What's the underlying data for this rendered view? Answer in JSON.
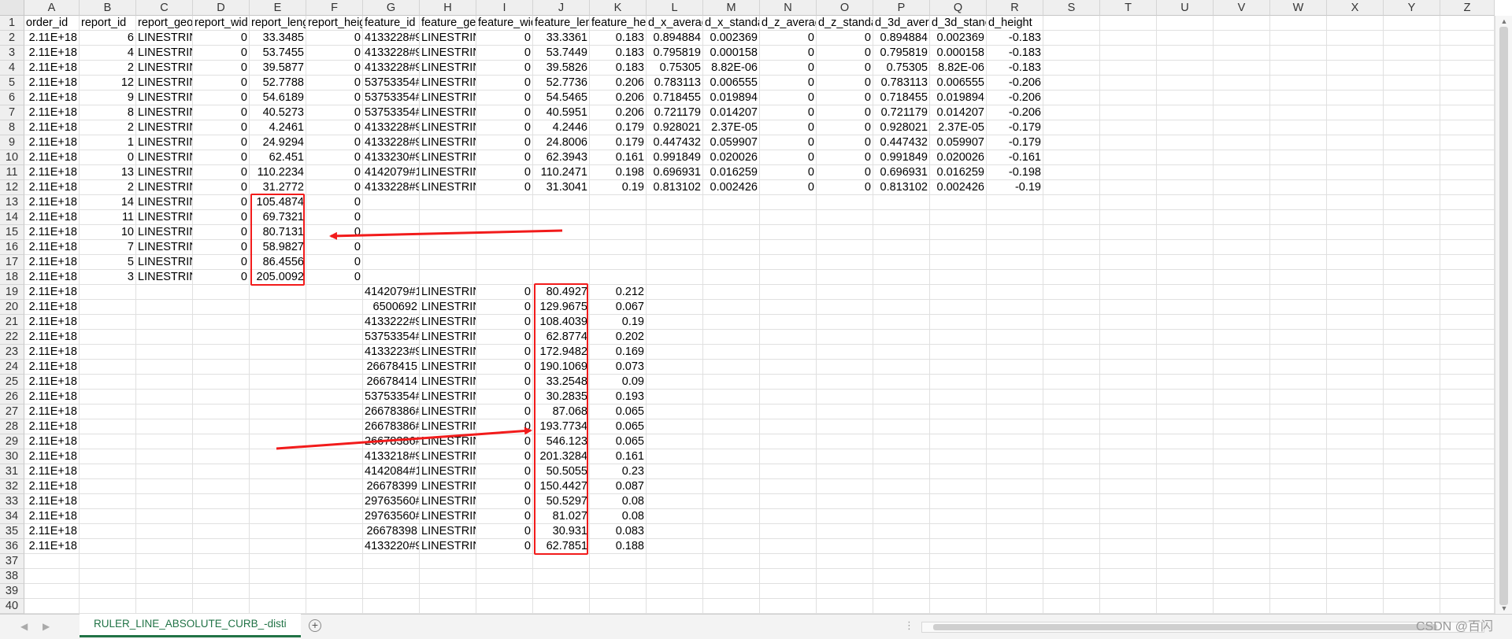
{
  "sheet": {
    "columns": [
      "A",
      "B",
      "C",
      "D",
      "E",
      "F",
      "G",
      "H",
      "I",
      "J",
      "K",
      "L",
      "M",
      "N",
      "O",
      "P",
      "Q",
      "R",
      "S",
      "T",
      "U",
      "V",
      "W",
      "X",
      "Y",
      "Z"
    ],
    "rows_count": 40,
    "headers": [
      "order_id",
      "report_id",
      "report_geo",
      "report_wid",
      "report_leng",
      "report_heig",
      "feature_id",
      "feature_ge",
      "feature_wid",
      "feature_len",
      "feature_he",
      "d_x_averag",
      "d_x_standa",
      "d_z_averag",
      "d_z_standa",
      "d_3d_avera",
      "d_3d_stanc",
      "d_height"
    ],
    "data": [
      [
        "2.11E+18",
        "6",
        "LINESTRIN",
        "0",
        "33.3485",
        "0",
        "4133228#9",
        "LINESTRIN",
        "0",
        "33.3361",
        "0.183",
        "0.894884",
        "0.002369",
        "0",
        "0",
        "0.894884",
        "0.002369",
        "-0.183"
      ],
      [
        "2.11E+18",
        "4",
        "LINESTRIN",
        "0",
        "53.7455",
        "0",
        "4133228#9",
        "LINESTRIN",
        "0",
        "53.7449",
        "0.183",
        "0.795819",
        "0.000158",
        "0",
        "0",
        "0.795819",
        "0.000158",
        "-0.183"
      ],
      [
        "2.11E+18",
        "2",
        "LINESTRIN",
        "0",
        "39.5877",
        "0",
        "4133228#9",
        "LINESTRIN",
        "0",
        "39.5826",
        "0.183",
        "0.75305",
        "8.82E-06",
        "0",
        "0",
        "0.75305",
        "8.82E-06",
        "-0.183"
      ],
      [
        "2.11E+18",
        "12",
        "LINESTRIN",
        "0",
        "52.7788",
        "0",
        "53753354#",
        "LINESTRIN",
        "0",
        "52.7736",
        "0.206",
        "0.783113",
        "0.006555",
        "0",
        "0",
        "0.783113",
        "0.006555",
        "-0.206"
      ],
      [
        "2.11E+18",
        "9",
        "LINESTRIN",
        "0",
        "54.6189",
        "0",
        "53753354#",
        "LINESTRIN",
        "0",
        "54.5465",
        "0.206",
        "0.718455",
        "0.019894",
        "0",
        "0",
        "0.718455",
        "0.019894",
        "-0.206"
      ],
      [
        "2.11E+18",
        "8",
        "LINESTRIN",
        "0",
        "40.5273",
        "0",
        "53753354#",
        "LINESTRIN",
        "0",
        "40.5951",
        "0.206",
        "0.721179",
        "0.014207",
        "0",
        "0",
        "0.721179",
        "0.014207",
        "-0.206"
      ],
      [
        "2.11E+18",
        "2",
        "LINESTRIN",
        "0",
        "4.2461",
        "0",
        "4133228#9",
        "LINESTRIN",
        "0",
        "4.2446",
        "0.179",
        "0.928021",
        "2.37E-05",
        "0",
        "0",
        "0.928021",
        "2.37E-05",
        "-0.179"
      ],
      [
        "2.11E+18",
        "1",
        "LINESTRIN",
        "0",
        "24.9294",
        "0",
        "4133228#9",
        "LINESTRIN",
        "0",
        "24.8006",
        "0.179",
        "0.447432",
        "0.059907",
        "0",
        "0",
        "0.447432",
        "0.059907",
        "-0.179"
      ],
      [
        "2.11E+18",
        "0",
        "LINESTRIN",
        "0",
        "62.451",
        "0",
        "4133230#9",
        "LINESTRIN",
        "0",
        "62.3943",
        "0.161",
        "0.991849",
        "0.020026",
        "0",
        "0",
        "0.991849",
        "0.020026",
        "-0.161"
      ],
      [
        "2.11E+18",
        "13",
        "LINESTRIN",
        "0",
        "110.2234",
        "0",
        "4142079#1",
        "LINESTRIN",
        "0",
        "110.2471",
        "0.198",
        "0.696931",
        "0.016259",
        "0",
        "0",
        "0.696931",
        "0.016259",
        "-0.198"
      ],
      [
        "2.11E+18",
        "2",
        "LINESTRIN",
        "0",
        "31.2772",
        "0",
        "4133228#9",
        "LINESTRIN",
        "0",
        "31.3041",
        "0.19",
        "0.813102",
        "0.002426",
        "0",
        "0",
        "0.813102",
        "0.002426",
        "-0.19"
      ],
      [
        "2.11E+18",
        "14",
        "LINESTRIN",
        "0",
        "105.4874",
        "0"
      ],
      [
        "2.11E+18",
        "11",
        "LINESTRIN",
        "0",
        "69.7321",
        "0"
      ],
      [
        "2.11E+18",
        "10",
        "LINESTRIN",
        "0",
        "80.7131",
        "0"
      ],
      [
        "2.11E+18",
        "7",
        "LINESTRIN",
        "0",
        "58.9827",
        "0"
      ],
      [
        "2.11E+18",
        "5",
        "LINESTRIN",
        "0",
        "86.4556",
        "0"
      ],
      [
        "2.11E+18",
        "3",
        "LINESTRIN",
        "0",
        "205.0092",
        "0"
      ],
      [
        "2.11E+18",
        "",
        "",
        "",
        "",
        "",
        "4142079#1",
        "LINESTRIN",
        "0",
        "80.4927",
        "0.212"
      ],
      [
        "2.11E+18",
        "",
        "",
        "",
        "",
        "",
        "6500692",
        "LINESTRIN",
        "0",
        "129.9675",
        "0.067"
      ],
      [
        "2.11E+18",
        "",
        "",
        "",
        "",
        "",
        "4133222#9",
        "LINESTRIN",
        "0",
        "108.4039",
        "0.19"
      ],
      [
        "2.11E+18",
        "",
        "",
        "",
        "",
        "",
        "53753354#",
        "LINESTRIN",
        "0",
        "62.8774",
        "0.202"
      ],
      [
        "2.11E+18",
        "",
        "",
        "",
        "",
        "",
        "4133223#9",
        "LINESTRIN",
        "0",
        "172.9482",
        "0.169"
      ],
      [
        "2.11E+18",
        "",
        "",
        "",
        "",
        "",
        "26678415",
        "LINESTRIN",
        "0",
        "190.1069",
        "0.073"
      ],
      [
        "2.11E+18",
        "",
        "",
        "",
        "",
        "",
        "26678414",
        "LINESTRIN",
        "0",
        "33.2548",
        "0.09"
      ],
      [
        "2.11E+18",
        "",
        "",
        "",
        "",
        "",
        "53753354#",
        "LINESTRIN",
        "0",
        "30.2835",
        "0.193"
      ],
      [
        "2.11E+18",
        "",
        "",
        "",
        "",
        "",
        "26678386#",
        "LINESTRIN",
        "0",
        "87.068",
        "0.065"
      ],
      [
        "2.11E+18",
        "",
        "",
        "",
        "",
        "",
        "26678386#",
        "LINESTRIN",
        "0",
        "193.7734",
        "0.065"
      ],
      [
        "2.11E+18",
        "",
        "",
        "",
        "",
        "",
        "26678386#",
        "LINESTRIN",
        "0",
        "546.123",
        "0.065"
      ],
      [
        "2.11E+18",
        "",
        "",
        "",
        "",
        "",
        "4133218#9",
        "LINESTRIN",
        "0",
        "201.3284",
        "0.161"
      ],
      [
        "2.11E+18",
        "",
        "",
        "",
        "",
        "",
        "4142084#1",
        "LINESTRIN",
        "0",
        "50.5055",
        "0.23"
      ],
      [
        "2.11E+18",
        "",
        "",
        "",
        "",
        "",
        "26678399",
        "LINESTRIN",
        "0",
        "150.4427",
        "0.087"
      ],
      [
        "2.11E+18",
        "",
        "",
        "",
        "",
        "",
        "29763560#",
        "LINESTRIN",
        "0",
        "50.5297",
        "0.08"
      ],
      [
        "2.11E+18",
        "",
        "",
        "",
        "",
        "",
        "29763560#",
        "LINESTRIN",
        "0",
        "81.027",
        "0.08"
      ],
      [
        "2.11E+18",
        "",
        "",
        "",
        "",
        "",
        "26678398",
        "LINESTRIN",
        "0",
        "30.931",
        "0.083"
      ],
      [
        "2.11E+18",
        "",
        "",
        "",
        "",
        "",
        "4133220#9",
        "LINESTRIN",
        "0",
        "62.7851",
        "0.188"
      ]
    ]
  },
  "tabs": {
    "sheet_name": "RULER_LINE_ABSOLUTE_CURB_-disti"
  },
  "watermark": "CSDN @百闪",
  "colors": {
    "annotation": "#f21b1b",
    "accent": "#217346"
  }
}
